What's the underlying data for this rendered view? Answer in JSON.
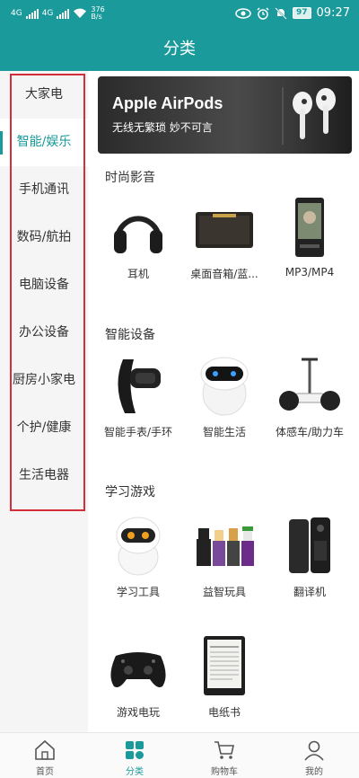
{
  "status_bar": {
    "sim1": "4G",
    "sim2": "4G",
    "speed_value": "376",
    "speed_unit": "B/s",
    "battery": "97",
    "time": "09:27"
  },
  "header": {
    "title": "分类"
  },
  "sidebar": {
    "items": [
      {
        "label": "大家电"
      },
      {
        "label": "智能/娱乐"
      },
      {
        "label": "手机通讯"
      },
      {
        "label": "数码/航拍"
      },
      {
        "label": "电脑设备"
      },
      {
        "label": "办公设备"
      },
      {
        "label": "厨房小家电"
      },
      {
        "label": "个护/健康"
      },
      {
        "label": "生活电器"
      }
    ],
    "active_index": 1
  },
  "banner": {
    "title": "Apple AirPods",
    "subtitle": "无线无繁琐 妙不可言"
  },
  "sections": [
    {
      "title": "时尚影音",
      "products": [
        {
          "label": "耳机",
          "icon": "headphones-icon"
        },
        {
          "label": "桌面音箱/蓝...",
          "icon": "speaker-icon"
        },
        {
          "label": "MP3/MP4",
          "icon": "mp3-player-icon"
        }
      ]
    },
    {
      "title": "智能设备",
      "products": [
        {
          "label": "智能手表/手环",
          "icon": "smart-band-icon"
        },
        {
          "label": "智能生活",
          "icon": "robot-icon"
        },
        {
          "label": "体感车/助力车",
          "icon": "balance-scooter-icon"
        }
      ]
    },
    {
      "title": "学习游戏",
      "products": [
        {
          "label": "学习工具",
          "icon": "learning-robot-icon"
        },
        {
          "label": "益智玩具",
          "icon": "lego-figures-icon"
        },
        {
          "label": "翻译机",
          "icon": "translator-icon"
        },
        {
          "label": "游戏电玩",
          "icon": "gamepad-icon"
        },
        {
          "label": "电纸书",
          "icon": "ereader-icon"
        }
      ]
    }
  ],
  "tabbar": {
    "items": [
      {
        "label": "首页",
        "icon": "home-icon"
      },
      {
        "label": "分类",
        "icon": "category-icon"
      },
      {
        "label": "购物车",
        "icon": "cart-icon"
      },
      {
        "label": "我的",
        "icon": "user-icon"
      }
    ],
    "active_index": 1
  },
  "colors": {
    "accent": "#1a9a9a",
    "highlight_outline": "#d32f3a"
  }
}
